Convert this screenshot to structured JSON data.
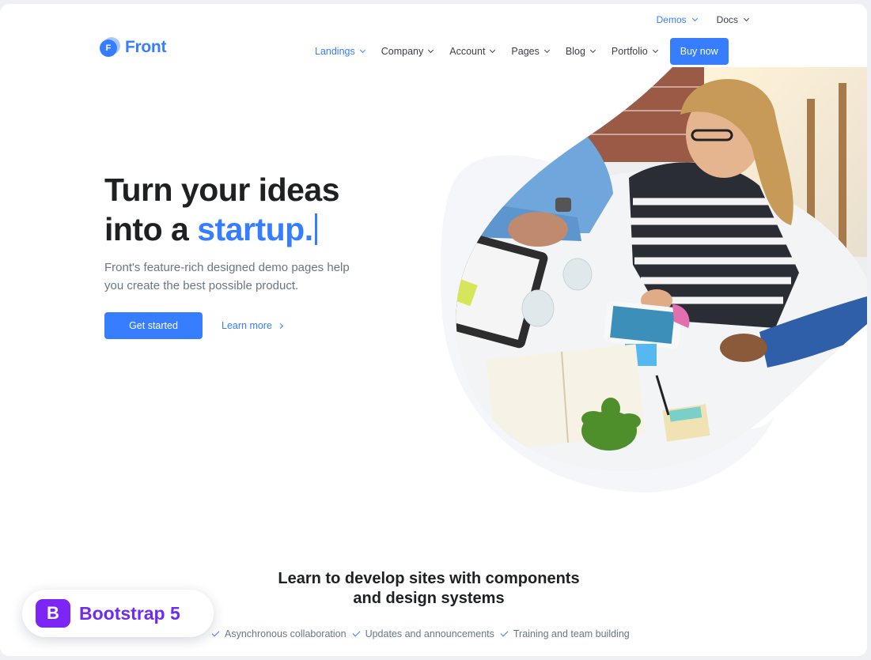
{
  "topbar": {
    "items": [
      {
        "label": "Demos",
        "active": true
      },
      {
        "label": "Docs",
        "active": false
      }
    ]
  },
  "brand": {
    "name": "Front",
    "mark": "F"
  },
  "nav": {
    "links": [
      "Landings",
      "Company",
      "Account",
      "Pages",
      "Blog",
      "Portfolio"
    ],
    "cta": "Buy now"
  },
  "hero": {
    "title_line1": "Turn your ideas",
    "title_line2_prefix": "into a",
    "title_accent": "startup.",
    "description": "Front's feature-rich designed demo pages help you create the best possible product.",
    "primary_button": "Get started",
    "secondary_link": "Learn more"
  },
  "section": {
    "title_line1": "Learn to develop sites with components",
    "title_line2": "and design systems",
    "features": [
      "Asynchronous collaboration",
      "Updates and announcements",
      "Training and team building"
    ]
  },
  "badge": {
    "logo": "B",
    "text": "Bootstrap 5"
  },
  "colors": {
    "primary": "#377dff",
    "bootstrap": "#7b26f5",
    "heading": "#1e2022",
    "body": "#677788"
  }
}
